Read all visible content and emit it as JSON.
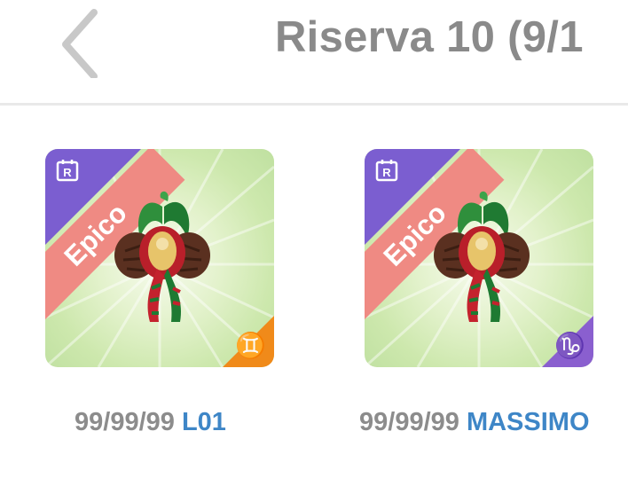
{
  "header": {
    "title": "Riserva 10 (9/1",
    "back_icon": "chevron-left-icon"
  },
  "cards": [
    {
      "rarity": "Epico",
      "badge": "R",
      "zodiac_symbol": "♊",
      "zodiac_icon": "gemini-icon",
      "corner_color": "#f08a1a",
      "date": "99/99/99",
      "name": "L01"
    },
    {
      "rarity": "Epico",
      "badge": "R",
      "zodiac_symbol": "♑",
      "zodiac_icon": "capricorn-icon",
      "corner_color": "#8a5fcf",
      "date": "99/99/99",
      "name": "MASSIMO"
    }
  ],
  "colors": {
    "rarity_ribbon": "#ef8a83",
    "badge_corner": "#7b5ed0",
    "title_text": "#8a8a8a",
    "name_text": "#3e86c7"
  }
}
